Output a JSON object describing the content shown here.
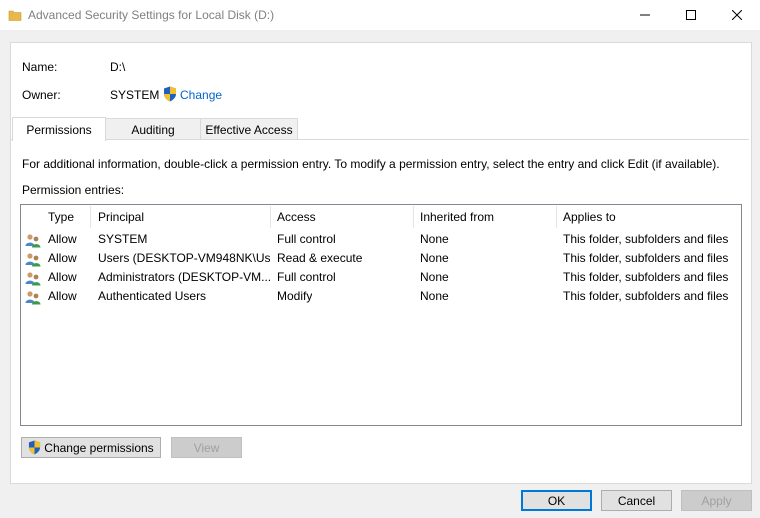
{
  "window": {
    "title": "Advanced Security Settings for Local Disk (D:)"
  },
  "info": {
    "name_label": "Name:",
    "name_value": "D:\\",
    "owner_label": "Owner:",
    "owner_value": "SYSTEM",
    "change_link": "Change"
  },
  "tabs": [
    {
      "label": "Permissions",
      "active": true
    },
    {
      "label": "Auditing",
      "active": false
    },
    {
      "label": "Effective Access",
      "active": false
    }
  ],
  "instructions": "For additional information, double-click a permission entry. To modify a permission entry, select the entry and click Edit (if available).",
  "entries_label": "Permission entries:",
  "table": {
    "headers": [
      "Type",
      "Principal",
      "Access",
      "Inherited from",
      "Applies to"
    ],
    "rows": [
      {
        "type": "Allow",
        "principal": "SYSTEM",
        "access": "Full control",
        "inherited": "None",
        "applies": "This folder, subfolders and files"
      },
      {
        "type": "Allow",
        "principal": "Users (DESKTOP-VM948NK\\Us...",
        "access": "Read & execute",
        "inherited": "None",
        "applies": "This folder, subfolders and files"
      },
      {
        "type": "Allow",
        "principal": "Administrators (DESKTOP-VM...",
        "access": "Full control",
        "inherited": "None",
        "applies": "This folder, subfolders and files"
      },
      {
        "type": "Allow",
        "principal": "Authenticated Users",
        "access": "Modify",
        "inherited": "None",
        "applies": "This folder, subfolders and files"
      }
    ]
  },
  "buttons": {
    "change_permissions": "Change permissions",
    "view": "View",
    "ok": "OK",
    "cancel": "Cancel",
    "apply": "Apply"
  },
  "colors": {
    "link": "#0066cc",
    "accent": "#0078d7",
    "folder": "#e8b84a"
  }
}
